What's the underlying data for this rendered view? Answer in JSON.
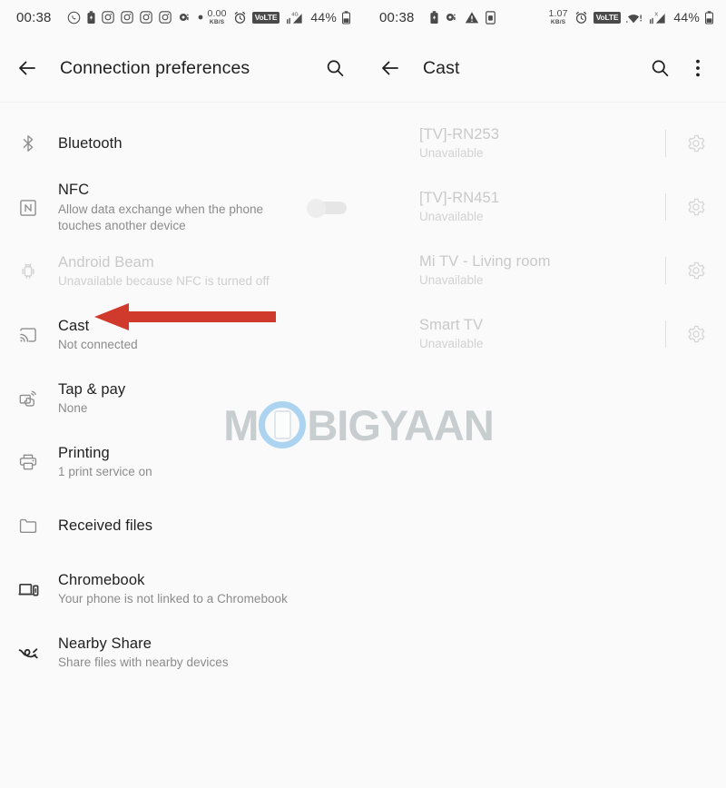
{
  "left_panel": {
    "statusbar": {
      "clock": "00:38",
      "icons": [
        "whatsapp-icon",
        "battery-saver-icon",
        "instagram-icon",
        "instagram-icon",
        "instagram-icon",
        "instagram-icon",
        "camera-icon",
        "dot-icon"
      ],
      "data_rate": "0.00",
      "data_rate_unit": "KB/S",
      "alarm_icon": "alarm-icon",
      "volte_label": "VoLTE",
      "signal_label": "4G",
      "battery_percent": "44%"
    },
    "appbar": {
      "back_icon": "arrow-back-icon",
      "title": "Connection preferences",
      "search_icon": "search-icon"
    },
    "items": [
      {
        "icon": "bluetooth-icon",
        "title": "Bluetooth",
        "subtitle": "",
        "disabled": false,
        "toggle": null
      },
      {
        "icon": "nfc-icon",
        "title": "NFC",
        "subtitle": "Allow data exchange when the phone touches another device",
        "disabled": false,
        "toggle": "off"
      },
      {
        "icon": "android-beam-icon",
        "title": "Android Beam",
        "subtitle": "Unavailable because NFC is turned off",
        "disabled": true,
        "toggle": null
      },
      {
        "icon": "cast-icon",
        "title": "Cast",
        "subtitle": "Not connected",
        "disabled": false,
        "toggle": null
      },
      {
        "icon": "tap-and-pay-icon",
        "title": "Tap & pay",
        "subtitle": "None",
        "disabled": false,
        "toggle": null
      },
      {
        "icon": "printer-icon",
        "title": "Printing",
        "subtitle": "1 print service on",
        "disabled": false,
        "toggle": null
      },
      {
        "icon": "folder-icon",
        "title": "Received files",
        "subtitle": "",
        "disabled": false,
        "toggle": null
      },
      {
        "icon": "chromebook-icon",
        "title": "Chromebook",
        "subtitle": "Your phone is not linked to a Chromebook",
        "disabled": false,
        "toggle": null
      },
      {
        "icon": "nearby-share-icon",
        "title": "Nearby Share",
        "subtitle": "Share files with nearby devices",
        "disabled": false,
        "toggle": null
      }
    ],
    "annotation": {
      "type": "arrow-left",
      "color": "#d03a2c",
      "points_to": "Cast"
    }
  },
  "right_panel": {
    "statusbar": {
      "clock": "00:38",
      "icons": [
        "battery-saver-icon",
        "camera-icon",
        "warning-icon",
        "sim-icon"
      ],
      "data_rate": "1.07",
      "data_rate_unit": "KB/S",
      "alarm_icon": "alarm-icon",
      "volte_label": "VoLTE",
      "wifi_icon": "wifi-alert-icon",
      "signal_label": "X",
      "battery_percent": "44%"
    },
    "appbar": {
      "back_icon": "arrow-back-icon",
      "title": "Cast",
      "search_icon": "search-icon",
      "overflow_icon": "more-vert-icon"
    },
    "devices": [
      {
        "name": "[TV]-RN253",
        "status": "Unavailable",
        "gear_icon": "gear-icon"
      },
      {
        "name": "[TV]-RN451",
        "status": "Unavailable",
        "gear_icon": "gear-icon"
      },
      {
        "name": "Mi TV - Living room",
        "status": "Unavailable",
        "gear_icon": "gear-icon"
      },
      {
        "name": "Smart TV",
        "status": "Unavailable",
        "gear_icon": "gear-icon"
      }
    ]
  },
  "watermark": {
    "part1": "M",
    "part2": "BIGYAAN",
    "logo_icon": "phone-in-circle-icon"
  }
}
